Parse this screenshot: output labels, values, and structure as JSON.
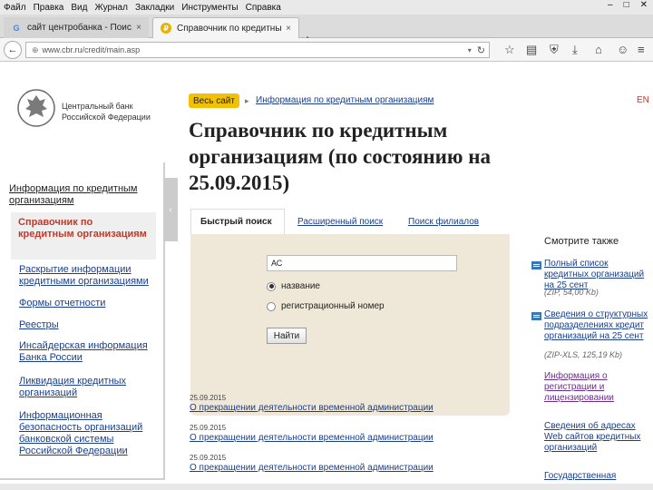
{
  "browser": {
    "menu": [
      "Файл",
      "Правка",
      "Вид",
      "Журнал",
      "Закладки",
      "Инструменты",
      "Справка"
    ],
    "tabs": [
      {
        "title": "сайт центробанка - Поис...",
        "close": "×"
      },
      {
        "title": "Справочник по кредитны...",
        "close": "×"
      }
    ],
    "new_tab": "+",
    "url": "www.cbr.ru/credit/main.asp"
  },
  "site": {
    "bank_name_line1": "Центральный банк",
    "bank_name_line2": "Российской Федерации",
    "lang": "EN"
  },
  "breadcrumb": {
    "all_site": "Весь сайт",
    "arrow": "▸",
    "link": "Информация по кредитным организациям"
  },
  "sidebar": {
    "heading": "Информация по кредитным организациям",
    "active": "Справочник по кредитным организациям",
    "items": [
      "Раскрытие информации кредитными организациями",
      "Формы отчетности",
      "Реестры",
      "Инсайдерская информация Банка России",
      "Ликвидация кредитных организаций",
      "Информационная безопасность организаций банковской системы Российской Федерации"
    ]
  },
  "main": {
    "title": "Справочник по кредитным организациям (по состоянию на 25.09.2015)",
    "tabs": [
      "Быстрый поиск",
      "Расширенный поиск",
      "Поиск филиалов"
    ],
    "search": {
      "value": "АС",
      "options": [
        "название",
        "регистрационный номер"
      ],
      "button": "Найти"
    },
    "news": [
      {
        "date": "25.09.2015",
        "title": "О прекращении деятельности временной администрации"
      },
      {
        "date": "25.09.2015",
        "title": "О прекращении деятельности временной администрации"
      },
      {
        "date": "25.09.2015",
        "title": "О прекращении деятельности временной администрации"
      }
    ]
  },
  "see_also": {
    "title": "Смотрите также",
    "items": [
      {
        "text": "Полный список кредитных организаций на 25 сент",
        "meta": "(ZIP, 54,00 Kb)"
      },
      {
        "text": "Сведения о структурных подразделениях кредит организаций на 25 сент",
        "meta": "(ZIP-XLS, 125,19 Kb)"
      }
    ],
    "links": [
      "Информация о регистрации и лицензировании",
      "Сведения об адресах Web сайтов кредитных организаций",
      "Государственная"
    ]
  },
  "icons": {
    "back": "←",
    "reload": "↻",
    "close": "×"
  }
}
